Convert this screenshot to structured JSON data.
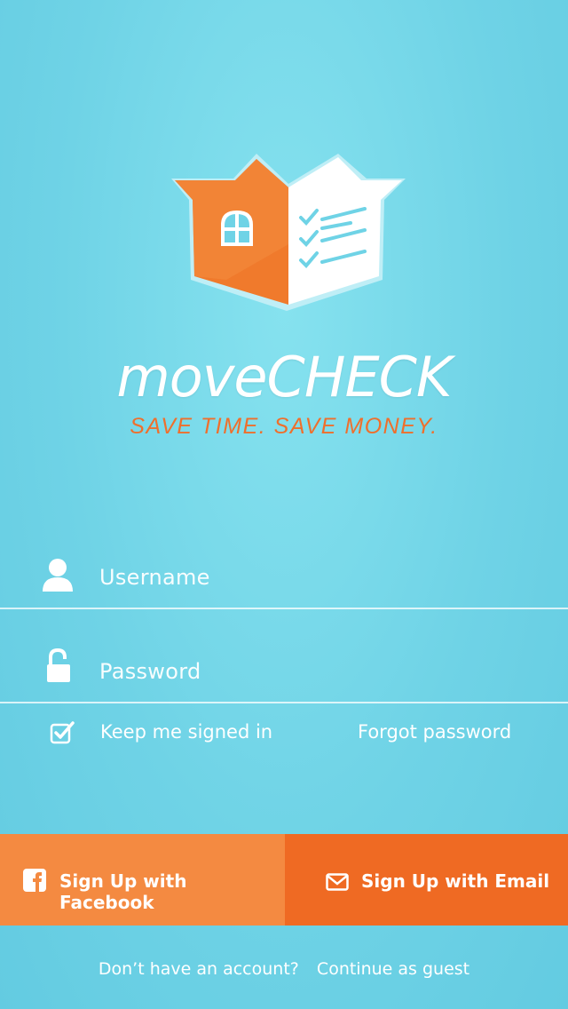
{
  "brand": {
    "name": "moveCHECK",
    "tagline": "SAVE TIME. SAVE MONEY."
  },
  "login": {
    "username_placeholder": "Username",
    "password_placeholder": "Password",
    "keep_signed_in": "Keep me signed in",
    "keep_signed_in_checked": true,
    "forgot_password": "Forgot password"
  },
  "signup": {
    "facebook_label": "Sign Up with Facebook",
    "email_label": "Sign Up with Email"
  },
  "footer": {
    "no_account": "Don’t have an account?",
    "guest": "Continue as guest"
  },
  "colors": {
    "background": "#6fd3e6",
    "accent_orange": "#ef6a23",
    "facebook_orange": "#f48a41",
    "tagline_orange": "#ef6f2c"
  }
}
